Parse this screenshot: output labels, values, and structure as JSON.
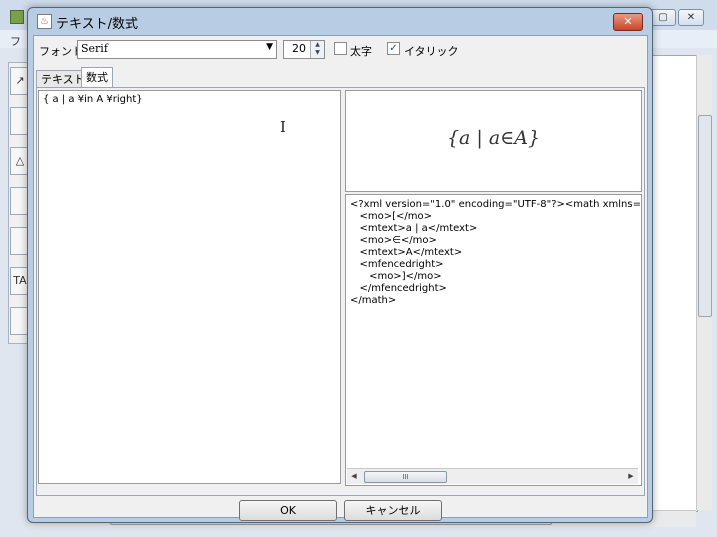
{
  "background_app": {
    "menu_text": "フ",
    "tools": [
      "↗",
      "",
      "△",
      "",
      "",
      "TA",
      ""
    ],
    "window_buttons": [
      "▢",
      "✕"
    ]
  },
  "dialog": {
    "title": "テキスト/数式",
    "close_label": "✕",
    "icon": "java-app-icon",
    "font_label": "フォント",
    "font_value": "Serif",
    "size_value": "20",
    "bold_label": "太字",
    "bold_checked": false,
    "italic_label": "イタリック",
    "italic_checked": true,
    "italic_checkmark": "✓",
    "tabs": [
      {
        "label": "テキスト",
        "active": false
      },
      {
        "label": "数式",
        "active": true
      }
    ],
    "editor_text": "{ a | a ¥in A ¥right}",
    "preview_formula": "{a | a∈A}",
    "xml_lines": [
      "<?xml version=\"1.0\" encoding=\"UTF-8\"?><math xmlns=\"",
      "   <mo>[</mo>",
      "   <mtext>a | a</mtext>",
      "   <mo>∈</mo>",
      "   <mtext>A</mtext>",
      "   <mfencedright>",
      "      <mo>]</mo>",
      "   </mfencedright>",
      "</math>"
    ],
    "scroll_thumb_grip": "III",
    "ok_label": "OK",
    "cancel_label": "キャンセル"
  }
}
